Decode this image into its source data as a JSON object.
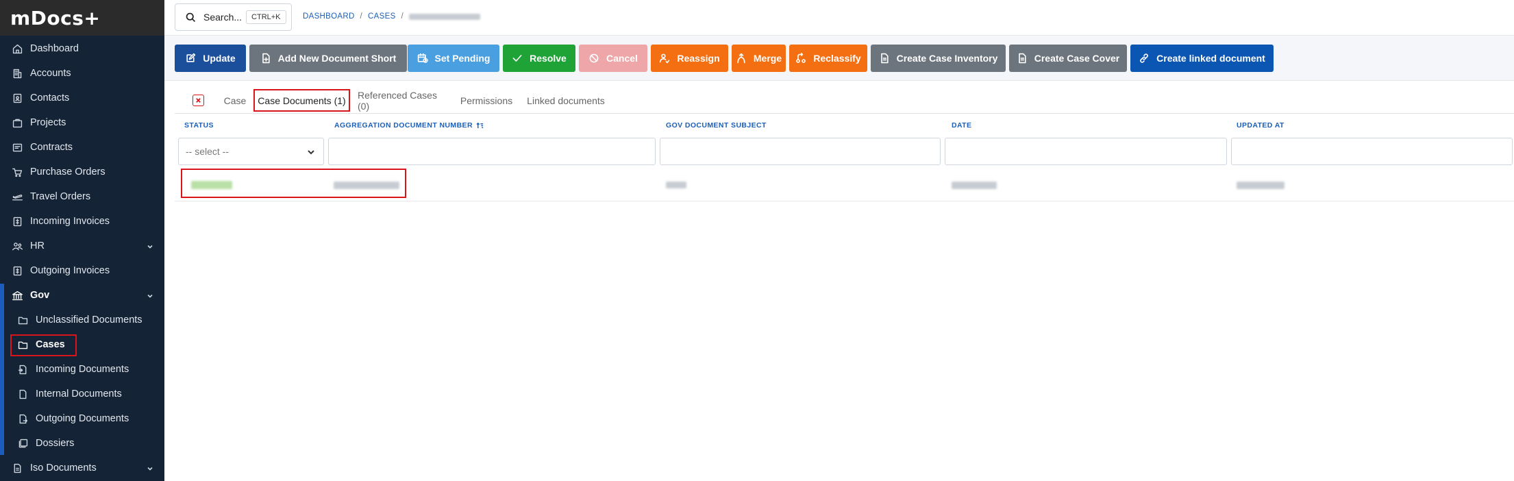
{
  "app": {
    "title": "mDocs+"
  },
  "sidebar": {
    "items": [
      {
        "label": "Dashboard",
        "icon": "home-icon"
      },
      {
        "label": "Accounts",
        "icon": "building-icon"
      },
      {
        "label": "Contacts",
        "icon": "contacts-icon"
      },
      {
        "label": "Projects",
        "icon": "briefcase-icon"
      },
      {
        "label": "Contracts",
        "icon": "contract-icon"
      },
      {
        "label": "Purchase Orders",
        "icon": "cart-icon"
      },
      {
        "label": "Travel Orders",
        "icon": "plane-icon"
      },
      {
        "label": "Incoming Invoices",
        "icon": "invoice-icon"
      },
      {
        "label": "HR",
        "icon": "people-icon",
        "expandable": true
      },
      {
        "label": "Outgoing Invoices",
        "icon": "invoice-out-icon"
      },
      {
        "label": "Gov",
        "icon": "bank-icon",
        "expandable": true,
        "expanded": true
      }
    ],
    "gov_items": [
      {
        "label": "Unclassified Documents",
        "icon": "folder-outline-icon"
      },
      {
        "label": "Cases",
        "icon": "folder-icon",
        "active": true
      },
      {
        "label": "Incoming Documents",
        "icon": "doc-in-icon"
      },
      {
        "label": "Internal Documents",
        "icon": "doc-icon"
      },
      {
        "label": "Outgoing Documents",
        "icon": "doc-out-icon"
      },
      {
        "label": "Dossiers",
        "icon": "stack-icon"
      }
    ],
    "bottom_items": [
      {
        "label": "Iso Documents",
        "icon": "iso-doc-icon",
        "expandable": true
      }
    ]
  },
  "search": {
    "label": "Search...",
    "shortcut": "CTRL+K"
  },
  "breadcrumb": {
    "items": [
      "DASHBOARD",
      "CASES"
    ],
    "separator": "/"
  },
  "actions": {
    "update": "Update",
    "add_new_document_short": "Add New Document Short",
    "set_pending": "Set Pending",
    "resolve": "Resolve",
    "cancel": "Cancel",
    "reassign": "Reassign",
    "merge": "Merge",
    "reclassify": "Reclassify",
    "create_case_inventory": "Create Case Inventory",
    "create_case_cover": "Create Case Cover",
    "create_linked_document": "Create linked document"
  },
  "colors": {
    "primary": "#1b4f9c",
    "secondary": "#6c757d",
    "info": "#4a9fe0",
    "success": "#1fa337",
    "danger_disabled": "#eea6a9",
    "warning": "#f36f12",
    "link": "#0b56b3",
    "highlight": "#d9151b"
  },
  "tabs": {
    "case": "Case",
    "case_documents": "Case Documents (1)",
    "referenced_cases": "Referenced Cases (0)",
    "permissions": "Permissions",
    "linked_documents": "Linked documents"
  },
  "table": {
    "headers": {
      "status": "STATUS",
      "aggregation_document_number": "AGGREGATION DOCUMENT NUMBER",
      "gov_document_subject": "GOV DOCUMENT SUBJECT",
      "date": "DATE",
      "updated_at": "UPDATED AT"
    },
    "status_filter_placeholder": "-- select --"
  }
}
